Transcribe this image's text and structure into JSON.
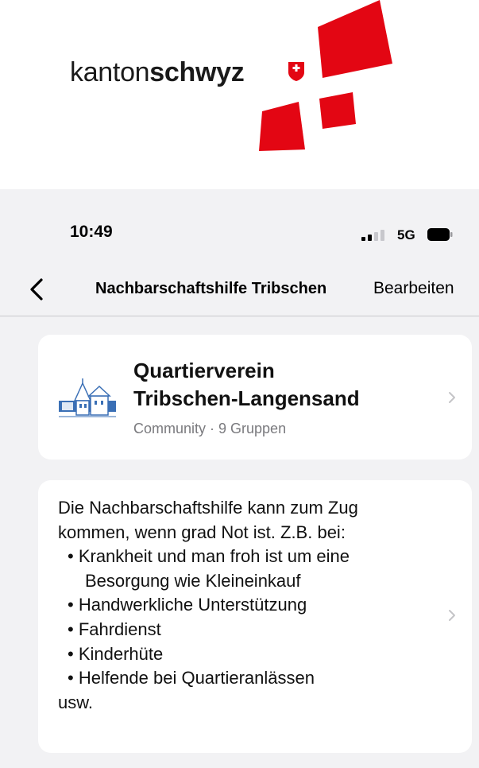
{
  "brand": {
    "word_light": "kanton",
    "word_bold": "schwyz",
    "red": "#e30613"
  },
  "statusbar": {
    "time": "10:49",
    "network": "5G",
    "icons": [
      "signal-icon",
      "battery-icon"
    ]
  },
  "navbar": {
    "back_icon": "chevron-left-icon",
    "title": "Nachbarschaftshilfe Tribschen",
    "edit_label": "Bearbeiten"
  },
  "community": {
    "name_line1": "Quartierverein",
    "name_line2": "Tribschen-Langensand",
    "subtitle": "Community · 9 Gruppen",
    "icon": "community-building-image"
  },
  "description": {
    "lines": [
      "Die Nachbarschaftshilfe kann zum Zug",
      "kommen, wenn grad Not ist. Z.B. bei:",
      "• Krankheit und man froh ist um eine",
      "Besorgung wie Kleineinkauf",
      "• Handwerkliche Unterstützung",
      "• Fahrdienst",
      "• Kinderhüte",
      "• Helfende bei Quartieranlässen",
      "usw."
    ]
  },
  "colors": {
    "background": "#f2f2f4",
    "card": "#ffffff",
    "secondary_text": "#7a7a7e",
    "chevron": "#c4c4c7"
  }
}
